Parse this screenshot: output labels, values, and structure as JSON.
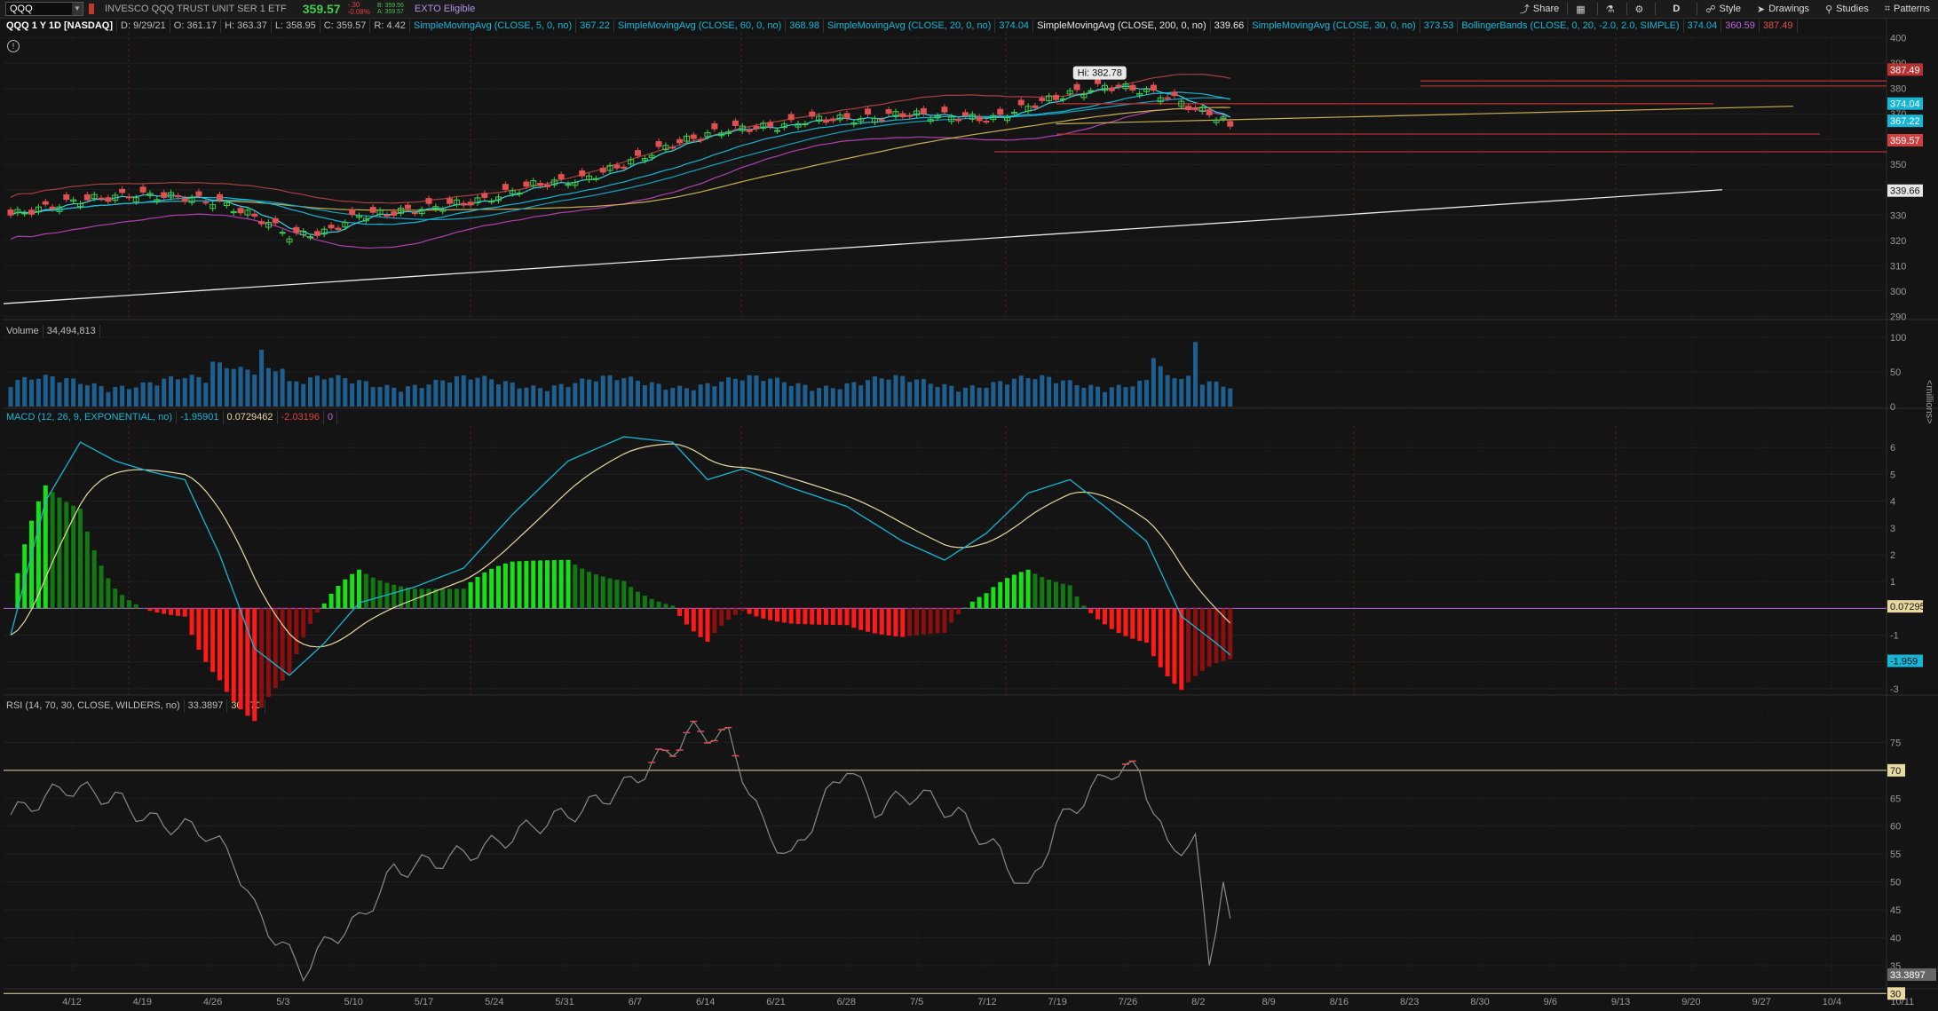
{
  "toolbar": {
    "symbol": "QQQ",
    "description": "INVESCO QQQ TRUST UNIT SER 1 ETF",
    "last": "359.57",
    "change": "-.30",
    "change_pct": "-0.08%",
    "bid": "B: 359.56",
    "ask": "A: 359.57",
    "exto": "EXTO Eligible",
    "buttons": {
      "share": "Share",
      "timeframe": "D",
      "style": "Style",
      "drawings": "Drawings",
      "studies": "Studies",
      "patterns": "Patterns"
    }
  },
  "price_pane": {
    "title": "QQQ 1 Y 1D [NASDAQ]",
    "ohlc": [
      "D: 9/29/21",
      "O: 361.17",
      "H: 363.37",
      "L: 358.95",
      "C: 359.57",
      "R: 4.42"
    ],
    "studies": [
      {
        "label": "SimpleMovingAvg (CLOSE, 5, 0, no)",
        "value": "367.22",
        "color": "#17b6d6"
      },
      {
        "label": "SimpleMovingAvg (CLOSE, 60, 0, no)",
        "value": "368.98",
        "color": "#c8b050"
      },
      {
        "label": "SimpleMovingAvg (CLOSE, 20, 0, no)",
        "value": "374.04",
        "color": "#17b6d6"
      },
      {
        "label": "SimpleMovingAvg (CLOSE, 200, 0, no)",
        "value": "339.66",
        "color": "#e8e8e8"
      },
      {
        "label": "SimpleMovingAvg (CLOSE, 30, 0, no)",
        "value": "373.53",
        "color": "#17b6d6"
      },
      {
        "label": "BollingerBands (CLOSE, 0, 20, -2.0, 2.0, SIMPLE)",
        "value": "374.04",
        "value2": "360.59",
        "value3": "387.49",
        "color": "#17b6d6"
      }
    ],
    "hi_label": "Hi: 382.78",
    "y_ticks": [
      "400",
      "390",
      "380",
      "370",
      "360",
      "350",
      "340",
      "330",
      "320",
      "310",
      "300",
      "290"
    ],
    "tags": [
      {
        "text": "387.49",
        "bg": "#b83232",
        "price": 387.49
      },
      {
        "text": "374.04",
        "bg": "#17b6d6",
        "price": 374.04
      },
      {
        "text": "367.22",
        "bg": "#17b6d6",
        "price": 367.22
      },
      {
        "text": "359.57",
        "bg": "#d04040",
        "price": 359.57
      },
      {
        "text": "339.66",
        "bg": "#e6e6e6",
        "price": 339.66
      }
    ]
  },
  "volume_pane": {
    "title": "Volume",
    "value": "34,494,813",
    "y_ticks": [
      "100",
      "50",
      "0"
    ],
    "unit": "<millions>"
  },
  "macd_pane": {
    "title": "MACD (12, 26, 9, EXPONENTIAL, no)",
    "values": [
      {
        "text": "-1.95901",
        "color": "#17b6d6"
      },
      {
        "text": "0.0729462",
        "color": "#e8d9a0"
      },
      {
        "text": "-2.03196",
        "color": "#e04040"
      },
      {
        "text": "0",
        "color": "#c066e0"
      }
    ],
    "y_ticks": [
      "6",
      "5",
      "4",
      "3",
      "2",
      "1",
      "-1",
      "-2",
      "-3"
    ],
    "tags": [
      {
        "text": "0.07295",
        "bg": "#e8d9a0"
      },
      {
        "text": "-1.959",
        "bg": "#17b6d6"
      }
    ]
  },
  "rsi_pane": {
    "title": "RSI (14, 70, 30, CLOSE, WILDERS, no)",
    "value": "33.3897",
    "ob": "30",
    "os": "70",
    "y_ticks": [
      "75",
      "65",
      "60",
      "55",
      "50",
      "45",
      "40",
      "35"
    ],
    "tags": [
      {
        "text": "70",
        "bg": "#e8d9a0"
      },
      {
        "text": "33.3897",
        "bg": "#666666"
      },
      {
        "text": "30",
        "bg": "#e8d9a0"
      }
    ]
  },
  "x_axis": [
    "4/12",
    "4/19",
    "4/26",
    "5/3",
    "5/10",
    "5/17",
    "5/24",
    "5/31",
    "6/7",
    "6/14",
    "6/21",
    "6/28",
    "7/5",
    "7/12",
    "7/19",
    "7/26",
    "8/2",
    "8/9",
    "8/16",
    "8/23",
    "8/30",
    "9/6",
    "9/13",
    "9/20",
    "9/27",
    "10/4",
    "10/11"
  ],
  "colors": {
    "up": "#3ecf4d",
    "down": "#e05050",
    "ma_cyan": "#17b6d6",
    "ma_olive": "#c8b050",
    "ma200": "#e8e8e8",
    "bb_upper": "#a84040",
    "bb_lower": "#b040b0"
  }
}
